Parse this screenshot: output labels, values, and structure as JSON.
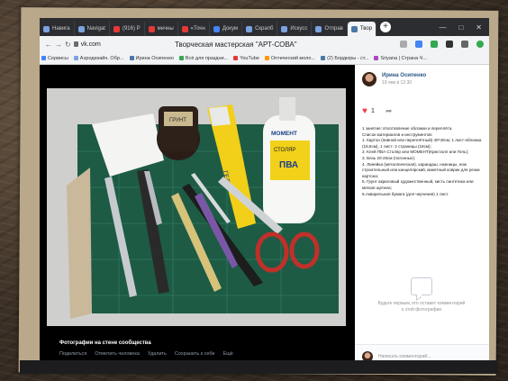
{
  "tabs": [
    {
      "label": "Навига",
      "color": "#7aa3e0"
    },
    {
      "label": "Navigat",
      "color": "#7aa3e0"
    },
    {
      "label": "(916) P",
      "color": "#e53935"
    },
    {
      "label": "мечны",
      "color": "#e53935"
    },
    {
      "label": "«Точн",
      "color": "#e53935"
    },
    {
      "label": "Докум",
      "color": "#4285f4"
    },
    {
      "label": "Скрапб",
      "color": "#7aa3e0"
    },
    {
      "label": "Искусс",
      "color": "#7aa3e0"
    },
    {
      "label": "Отправ",
      "color": "#7aa3e0"
    },
    {
      "label": "Твор",
      "color": "#4a76a8",
      "active": true
    }
  ],
  "browser": {
    "url": "vk.com",
    "page_title": "Творческая мастерская \"АРТ-СОВА\"",
    "new_tab": "+"
  },
  "bookmarks": [
    "Сервисы",
    "Аэродизайн. Обр...",
    "Ирина Осипенко",
    "Всё для праздни...",
    "YouTube",
    "Оптический моло...",
    "(2) Бордюры - ст...",
    "Sriyana | Страна Ч..."
  ],
  "post": {
    "author": "Ирина Осипенко",
    "date": "19 янв в 12:30",
    "likes": "1",
    "description": [
      "1 занятие: Изготовление обложки и переплёта.",
      "Список материалов и инструментов:",
      "1. Картон (пивной или переплётный) 40*40см; 1 лист-обложка (18,5см), 1 лист- 2 страницы (18см);",
      "2. Клей ПВА Столяр или МОМЕНТ(Кристалл или Гель);",
      "3. Бязь 20-20см (погонных);",
      "4. Линейка (металлическая), карандаш, ножницы, нож строительный или канцелярский, макетный коврик для резки картона;",
      "5. Грунт акриловый художественный, кисть синтетика или мягкая щетина;",
      "6.Акварельная бумага (для черчения) 1 лист."
    ],
    "no_comments": "Будьте первым, кто оставит комментарий к этой фотографии",
    "comment_placeholder": "Написать комментарий..."
  },
  "viewer": {
    "caption_title": "Фотографии на стене сообщества",
    "actions": [
      "Поделиться",
      "Отметить человека",
      "Удалить",
      "Сохранить к себе",
      "Ещё"
    ]
  },
  "photo_labels": {
    "jar": "ГРУНТ",
    "tube": "ГЕЛЬ",
    "bottle_brand": "МОМЕНТ",
    "bottle_sub": "СТОЛЯР",
    "bottle_pva": "ПВА"
  }
}
